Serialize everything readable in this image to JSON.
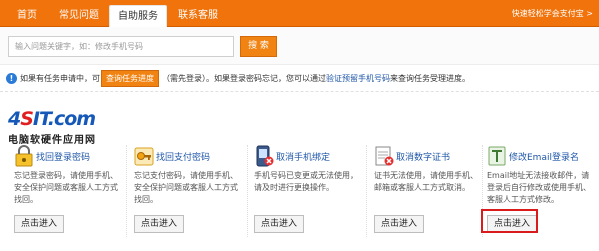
{
  "nav": {
    "tabs": [
      "首页",
      "常见问题",
      "自助服务",
      "联系客服"
    ],
    "active_index": 2,
    "quick_link": "快速轻松学会支付宝 >"
  },
  "search": {
    "placeholder": "输入问题关键字，如：修改手机号码",
    "button": "搜 索"
  },
  "info": {
    "icon": "!",
    "prefix": "如果有任务申请中，可",
    "query_button": "查询任务进度",
    "middle": "（需先登录）。如果登录密码忘记，您可以通过",
    "link": "验证预留手机号码",
    "suffix": "来查询任务受理进度。"
  },
  "logo": {
    "main": "4SIT.com",
    "sub": "电脑软硬件应用网"
  },
  "cards": [
    {
      "icon": "lock-icon",
      "title": "找回登录密码",
      "desc": "忘记登录密码，请使用手机、安全保护问题或客服人工方式找回。",
      "button": "点击进入"
    },
    {
      "icon": "key-icon",
      "title": "找回支付密码",
      "desc": "忘记支付密码，请使用手机、安全保护问题或客服人工方式找回。",
      "button": "点击进入"
    },
    {
      "icon": "phone-icon",
      "title": "取消手机绑定",
      "desc": "手机号码已变更或无法使用，请及时进行更换操作。",
      "button": "点击进入"
    },
    {
      "icon": "certificate-icon",
      "title": "取消数字证书",
      "desc": "证书无法使用，请使用手机、邮箱或客服人工方式取消。",
      "button": "点击进入"
    },
    {
      "icon": "email-icon",
      "title": "修改Email登录名",
      "desc": "Email地址无法接收邮件，请登录后自行修改或使用手机、客服人工方式修改。",
      "button": "点击进入"
    }
  ],
  "colors": {
    "accent": "#f0730c",
    "link": "#1f57a8",
    "highlight": "#d91b1b"
  }
}
